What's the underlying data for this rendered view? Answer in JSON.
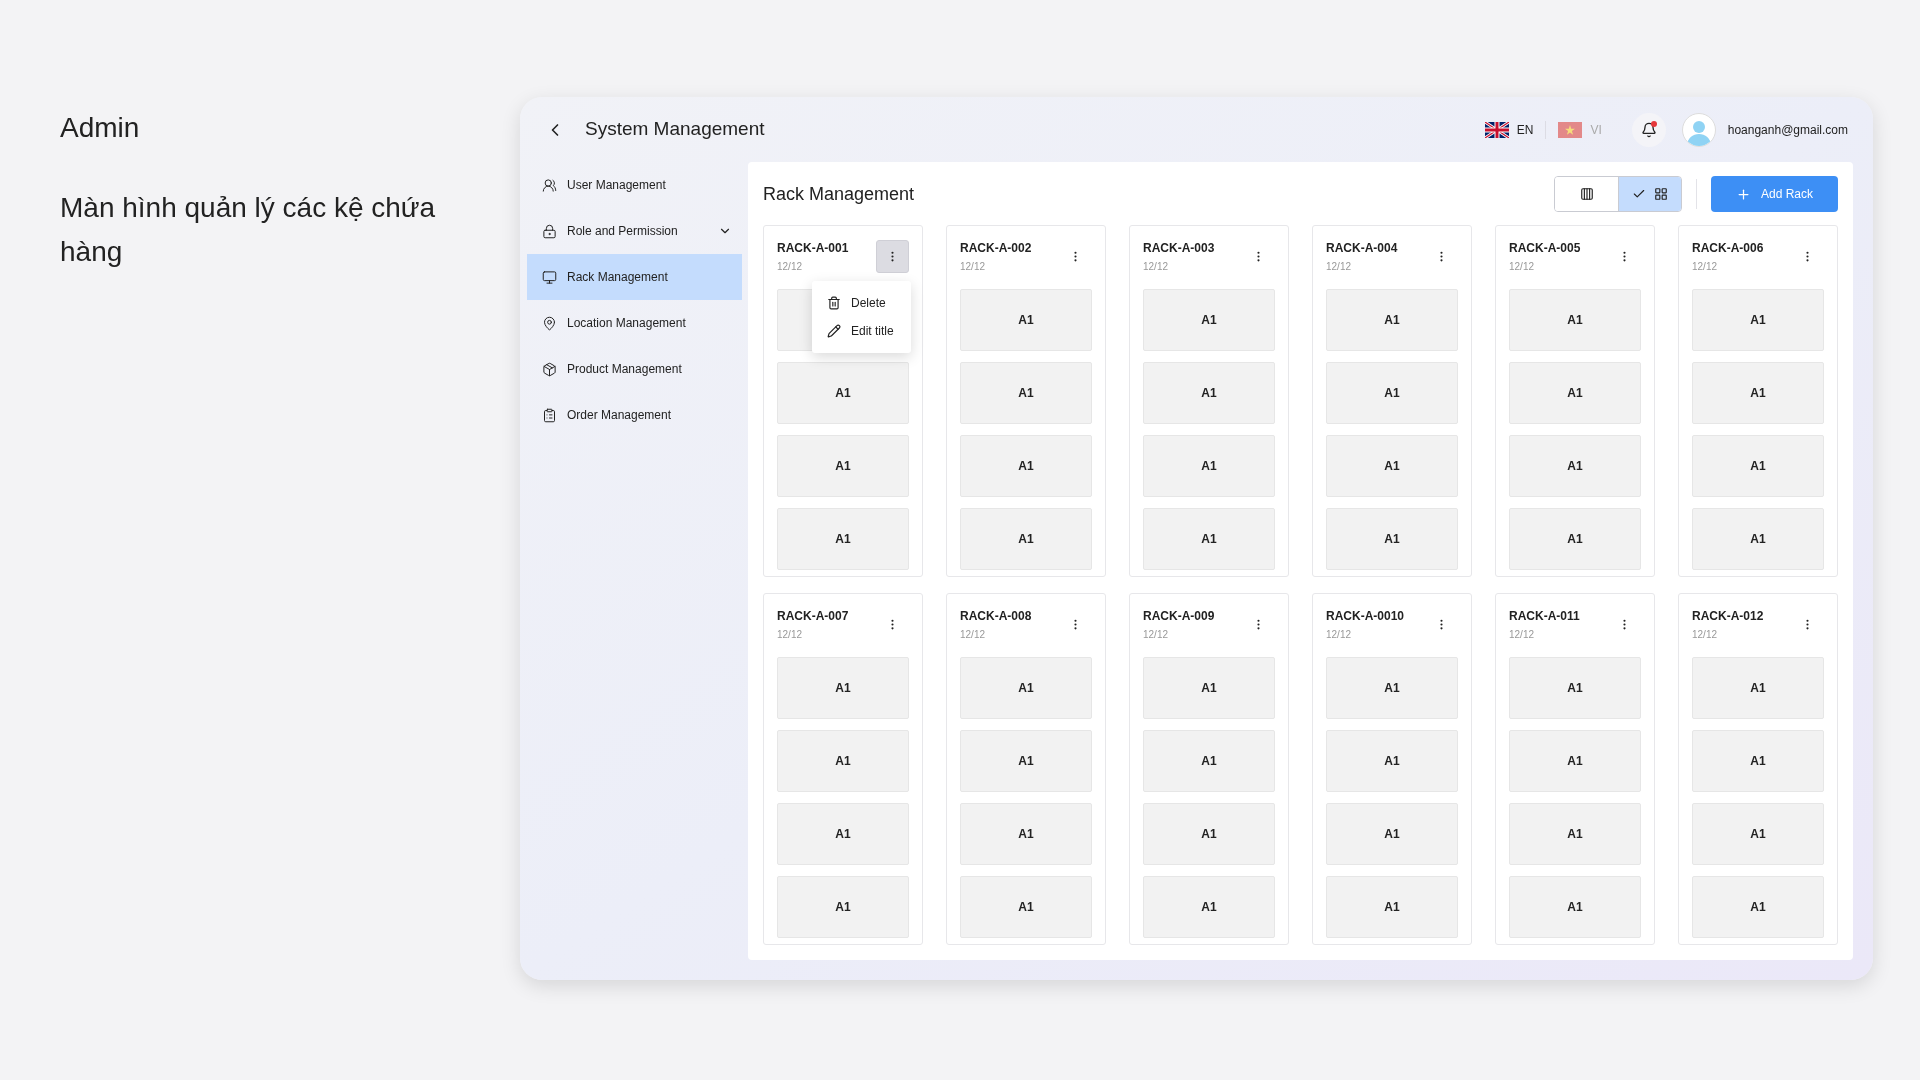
{
  "intro": {
    "title": "Admin",
    "description": "Màn hình quản lý các kệ chứa hàng"
  },
  "window": {
    "title": "System Management"
  },
  "languages": [
    {
      "code": "EN",
      "selected": true
    },
    {
      "code": "VI",
      "selected": false
    }
  ],
  "notifications": {
    "unread": true
  },
  "user": {
    "email": "hoanganh@gmail.com"
  },
  "sidebar": {
    "items": [
      {
        "label": "User Management",
        "selected": false,
        "expandable": false
      },
      {
        "label": "Role and Permission",
        "selected": false,
        "expandable": true
      },
      {
        "label": "Rack Management",
        "selected": true,
        "expandable": false
      },
      {
        "label": "Location Management",
        "selected": false,
        "expandable": false
      },
      {
        "label": "Product Management",
        "selected": false,
        "expandable": false
      },
      {
        "label": "Order Management",
        "selected": false,
        "expandable": false
      }
    ]
  },
  "content": {
    "title": "Rack Management",
    "view_toggle": [
      {
        "kind": "columns",
        "selected": false
      },
      {
        "kind": "grid",
        "selected": true
      }
    ],
    "add_button": "Add Rack",
    "racks": [
      {
        "name": "RACK-A-001",
        "count": "12/12",
        "menu_open": true,
        "slots": [
          {
            "label": "A1"
          },
          {
            "label": "A1"
          },
          {
            "label": "A1"
          }
        ]
      },
      {
        "name": "RACK-A-002",
        "count": "12/12",
        "menu_open": false,
        "slots": [
          {
            "label": "A1"
          },
          {
            "label": "A1"
          },
          {
            "label": "A1"
          },
          {
            "label": "A1"
          }
        ]
      },
      {
        "name": "RACK-A-003",
        "count": "12/12",
        "menu_open": false,
        "slots": [
          {
            "label": "A1"
          },
          {
            "label": "A1"
          },
          {
            "label": "A1"
          },
          {
            "label": "A1"
          }
        ]
      },
      {
        "name": "RACK-A-004",
        "count": "12/12",
        "menu_open": false,
        "slots": [
          {
            "label": "A1"
          },
          {
            "label": "A1"
          },
          {
            "label": "A1"
          },
          {
            "label": "A1"
          }
        ]
      },
      {
        "name": "RACK-A-005",
        "count": "12/12",
        "menu_open": false,
        "slots": [
          {
            "label": "A1"
          },
          {
            "label": "A1"
          },
          {
            "label": "A1"
          },
          {
            "label": "A1"
          }
        ]
      },
      {
        "name": "RACK-A-006",
        "count": "12/12",
        "menu_open": false,
        "slots": [
          {
            "label": "A1"
          },
          {
            "label": "A1"
          },
          {
            "label": "A1"
          },
          {
            "label": "A1"
          }
        ]
      },
      {
        "name": "RACK-A-007",
        "count": "12/12",
        "menu_open": false,
        "slots": [
          {
            "label": "A1"
          },
          {
            "label": "A1"
          },
          {
            "label": "A1"
          },
          {
            "label": "A1"
          }
        ]
      },
      {
        "name": "RACK-A-008",
        "count": "12/12",
        "menu_open": false,
        "slots": [
          {
            "label": "A1"
          },
          {
            "label": "A1"
          },
          {
            "label": "A1"
          },
          {
            "label": "A1"
          }
        ]
      },
      {
        "name": "RACK-A-009",
        "count": "12/12",
        "menu_open": false,
        "slots": [
          {
            "label": "A1"
          },
          {
            "label": "A1"
          },
          {
            "label": "A1"
          },
          {
            "label": "A1"
          }
        ]
      },
      {
        "name": "RACK-A-0010",
        "count": "12/12",
        "menu_open": false,
        "slots": [
          {
            "label": "A1"
          },
          {
            "label": "A1"
          },
          {
            "label": "A1"
          },
          {
            "label": "A1"
          }
        ]
      },
      {
        "name": "RACK-A-011",
        "count": "12/12",
        "menu_open": false,
        "slots": [
          {
            "label": "A1"
          },
          {
            "label": "A1"
          },
          {
            "label": "A1"
          },
          {
            "label": "A1"
          }
        ]
      },
      {
        "name": "RACK-A-012",
        "count": "12/12",
        "menu_open": false,
        "slots": [
          {
            "label": "A1"
          },
          {
            "label": "A1"
          },
          {
            "label": "A1"
          },
          {
            "label": "A1"
          }
        ]
      }
    ],
    "rack_menu": [
      {
        "label": "Delete"
      },
      {
        "label": "Edit title"
      }
    ]
  }
}
